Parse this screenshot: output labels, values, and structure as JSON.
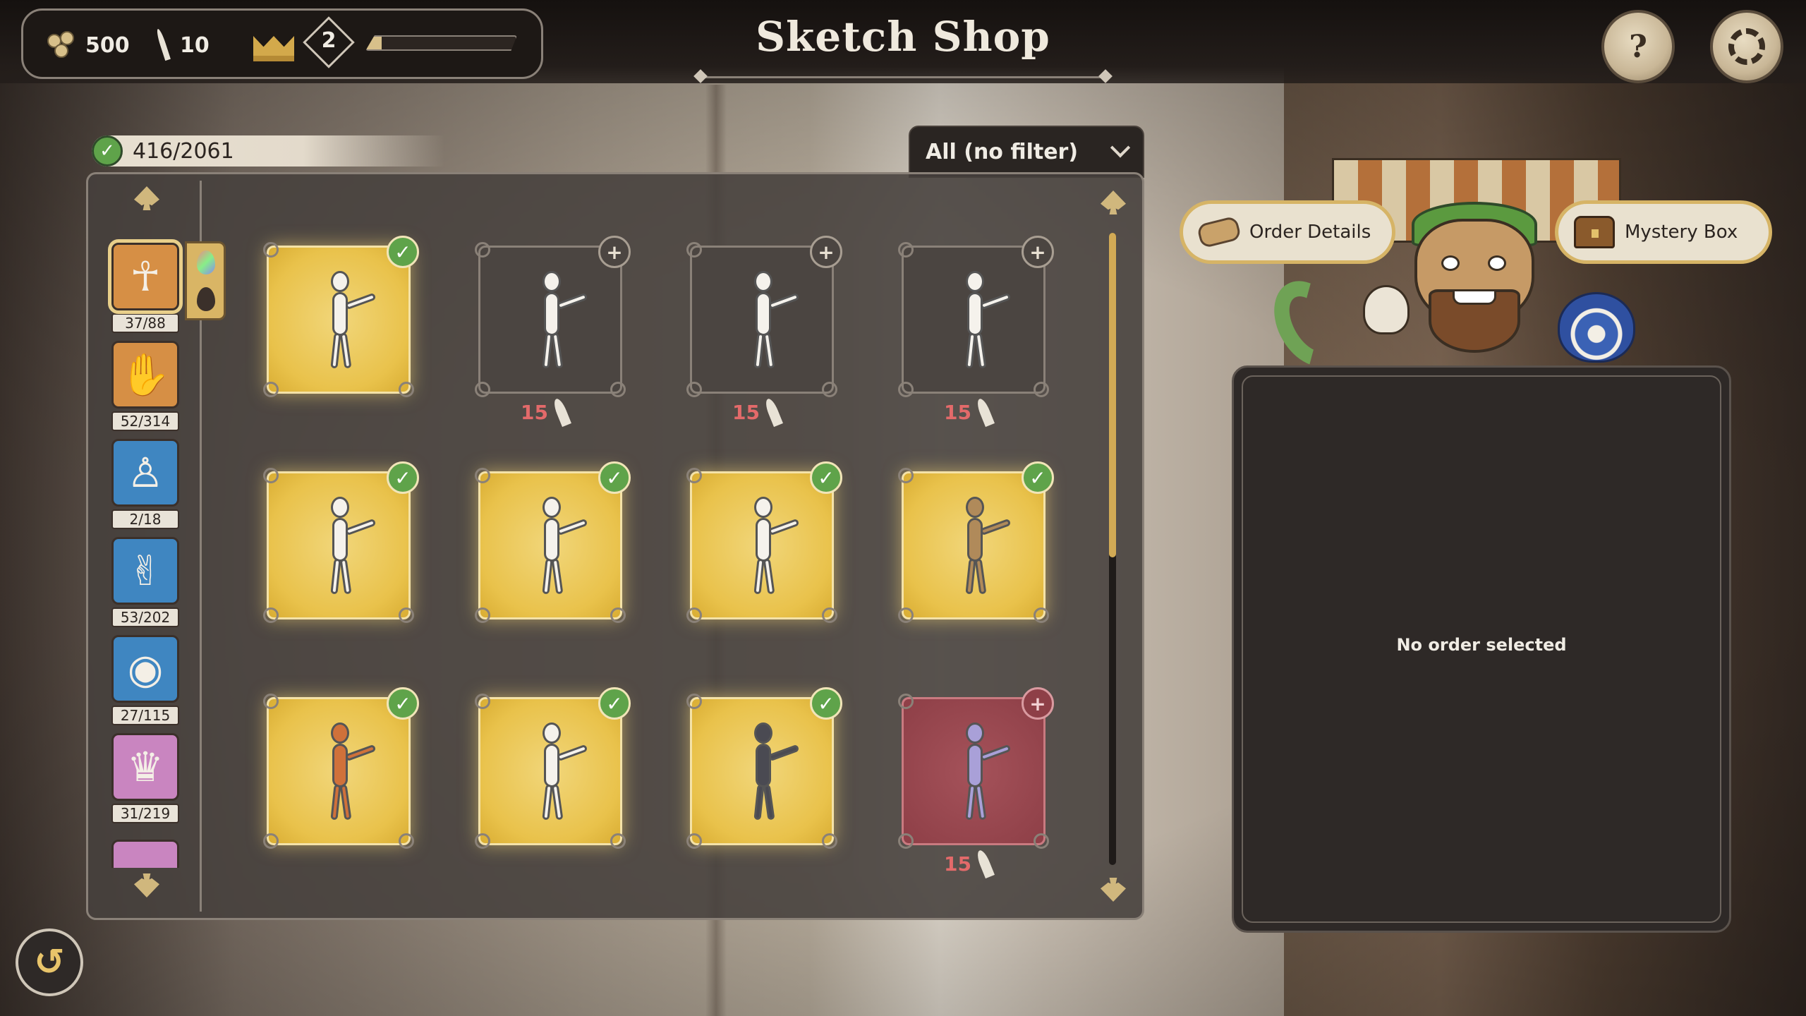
{
  "header": {
    "title": "Sketch Shop",
    "resources": {
      "coins": "500",
      "quills": "10",
      "level": "2",
      "level_progress": 0.1
    }
  },
  "collection": {
    "counter": "416/2061",
    "filter_selected": "All (no filter)"
  },
  "categories": [
    {
      "icon": "pose-icon",
      "count": "37/88",
      "color": "#d68f45",
      "selected": true
    },
    {
      "icon": "paw-icon",
      "count": "52/314",
      "color": "#d68f45"
    },
    {
      "icon": "body-icon",
      "count": "2/18",
      "color": "#3f86c1"
    },
    {
      "icon": "arm-icon",
      "count": "53/202",
      "color": "#3f86c1"
    },
    {
      "icon": "eye-icon",
      "count": "27/115",
      "color": "#3f86c1"
    },
    {
      "icon": "clothes-icon",
      "count": "31/219",
      "color": "#c985c0"
    }
  ],
  "sketches": [
    {
      "state": "owned",
      "figure": "white"
    },
    {
      "state": "locked",
      "figure": "white",
      "price": "15"
    },
    {
      "state": "locked",
      "figure": "white",
      "price": "15"
    },
    {
      "state": "locked",
      "figure": "white",
      "price": "15"
    },
    {
      "state": "owned",
      "figure": "white"
    },
    {
      "state": "owned",
      "figure": "white"
    },
    {
      "state": "owned",
      "figure": "white"
    },
    {
      "state": "owned",
      "figure": "tan"
    },
    {
      "state": "owned",
      "figure": "orange"
    },
    {
      "state": "owned",
      "figure": "white"
    },
    {
      "state": "owned",
      "figure": "dark"
    },
    {
      "state": "red",
      "figure": "lilac",
      "price": "15"
    }
  ],
  "shop": {
    "order_details_label": "Order Details",
    "mystery_box_label": "Mystery Box",
    "empty_order_text": "No order selected"
  }
}
